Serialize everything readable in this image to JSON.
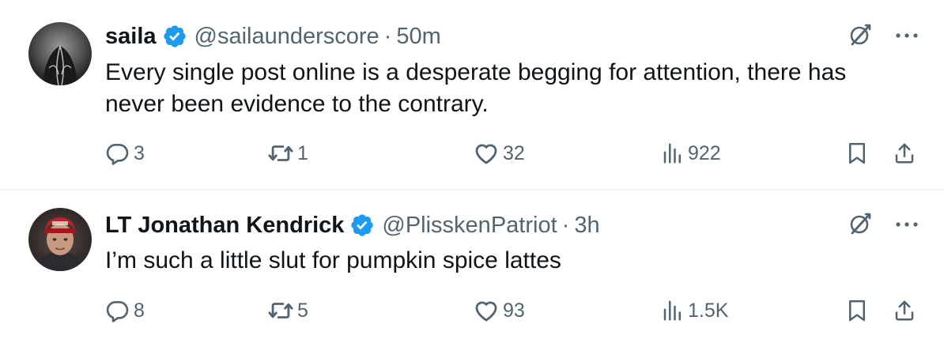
{
  "colors": {
    "verified_blue": "#1d9bf0",
    "text_primary": "#0f1419",
    "text_secondary": "#536471",
    "divider": "#eff3f4"
  },
  "tweets": [
    {
      "display_name": "saila",
      "handle": "@sailaunderscore",
      "separator": "·",
      "time": "50m",
      "text": "Every single post online is a desperate begging for attention, there has never been evidence to the contrary.",
      "counts": {
        "replies": "3",
        "reposts": "1",
        "likes": "32",
        "views": "922"
      },
      "icons": [
        "grok-icon",
        "more-icon",
        "reply-icon",
        "repost-icon",
        "like-icon",
        "views-icon",
        "bookmark-icon",
        "share-icon"
      ]
    },
    {
      "display_name": "LT Jonathan Kendrick",
      "handle": "@PlisskenPatriot",
      "separator": "·",
      "time": "3h",
      "text": "I’m such a little slut for pumpkin spice lattes",
      "counts": {
        "replies": "8",
        "reposts": "5",
        "likes": "93",
        "views": "1.5K"
      },
      "icons": [
        "grok-icon",
        "more-icon",
        "reply-icon",
        "repost-icon",
        "like-icon",
        "views-icon",
        "bookmark-icon",
        "share-icon"
      ]
    }
  ]
}
